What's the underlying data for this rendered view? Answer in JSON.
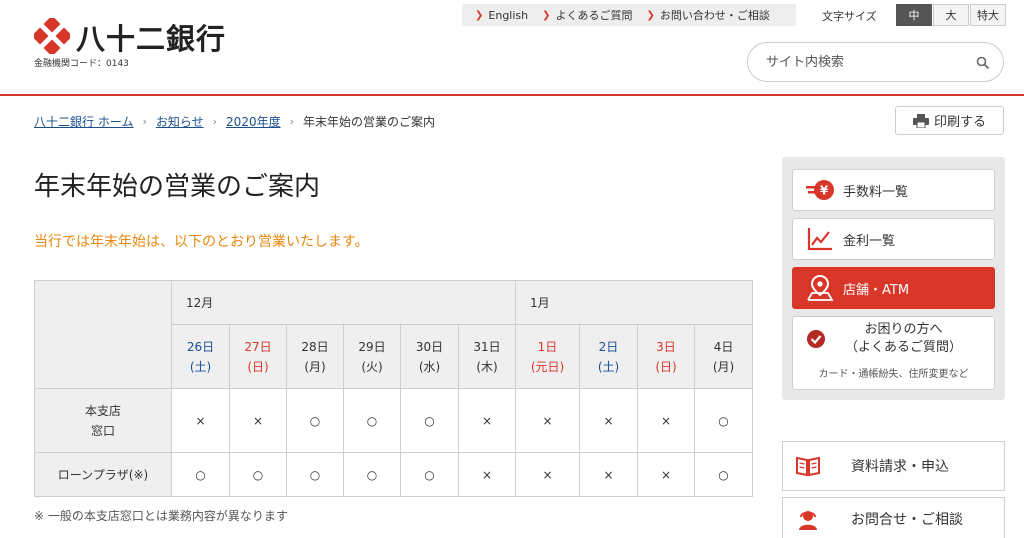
{
  "header": {
    "bank_name": "八十二銀行",
    "bank_code": "金融機関コード：0143",
    "util_links": [
      "English",
      "よくあるご質問",
      "お問い合わせ・ご相談"
    ],
    "font_size_label": "文字サイズ",
    "font_size_options": [
      "中",
      "大",
      "特大"
    ],
    "font_size_selected": "中",
    "search_placeholder": "サイト内検索"
  },
  "breadcrumb": {
    "items": [
      "八十二銀行 ホーム",
      "お知らせ",
      "2020年度"
    ],
    "current": "年末年始の営業のご案内"
  },
  "print_label": "印刷する",
  "page_title": "年末年始の営業のご案内",
  "lead": "当行では年末年始は、以下のとおり営業いたします。",
  "schedule": {
    "months": [
      "12月",
      "1月"
    ],
    "days": [
      {
        "d": "26日",
        "w": "(土)"
      },
      {
        "d": "27日",
        "w": "(日)"
      },
      {
        "d": "28日",
        "w": "(月)"
      },
      {
        "d": "29日",
        "w": "(火)"
      },
      {
        "d": "30日",
        "w": "(水)"
      },
      {
        "d": "31日",
        "w": "(木)"
      },
      {
        "d": "1日",
        "w": "(元日)"
      },
      {
        "d": "2日",
        "w": "(土)"
      },
      {
        "d": "3日",
        "w": "(日)"
      },
      {
        "d": "4日",
        "w": "(月)"
      }
    ],
    "rows": [
      {
        "label1": "本支店",
        "label2": "窓口",
        "cells": [
          "×",
          "×",
          "○",
          "○",
          "○",
          "×",
          "×",
          "×",
          "×",
          "○"
        ]
      },
      {
        "label1": "ローンプラザ(※)",
        "label2": "",
        "cells": [
          "○",
          "○",
          "○",
          "○",
          "○",
          "×",
          "×",
          "×",
          "×",
          "○"
        ]
      }
    ]
  },
  "note": "※ 一般の本支店窓口とは業務内容が異なります",
  "sidebar": {
    "fees": "手数料一覧",
    "rates": "金利一覧",
    "branches": "店舗・ATM",
    "help_title1": "お困りの方へ",
    "help_title2": "（よくあるご質問）",
    "help_sub": "カード・通帳紛失、住所変更など",
    "documents": "資料請求・申込",
    "contact": "お問合せ・ご相談"
  },
  "colors": {
    "brand_red": "#d9362a",
    "lead_orange": "#e8860f",
    "saturday_blue": "#1a4f9b",
    "holiday_red": "#d9362a"
  }
}
